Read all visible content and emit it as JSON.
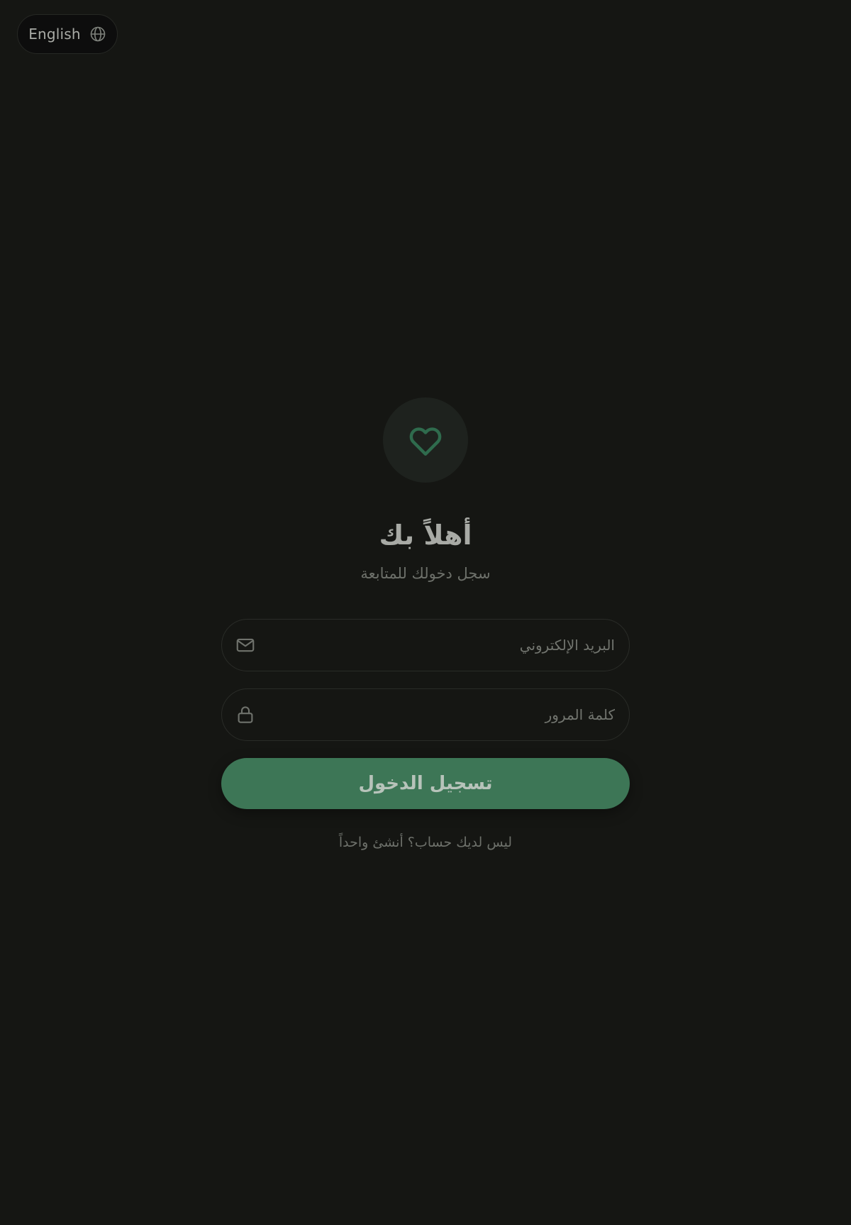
{
  "language_toggle": {
    "label": "English",
    "icon": "globe-icon"
  },
  "logo": {
    "icon": "heart-icon",
    "color": "#2f6b4d"
  },
  "header": {
    "title": "أهلاً بك",
    "subtitle": "سجل دخولك للمتابعة"
  },
  "form": {
    "email": {
      "placeholder": "البريد الإلكتروني",
      "value": "",
      "icon": "mail-icon"
    },
    "password": {
      "placeholder": "كلمة المرور",
      "value": "",
      "icon": "lock-icon"
    },
    "submit_label": "تسجيل الدخول"
  },
  "footer": {
    "signup_text": "ليس لديك حساب؟ أنشئ واحداً"
  },
  "colors": {
    "background": "#151613",
    "accent": "#3d7656"
  }
}
